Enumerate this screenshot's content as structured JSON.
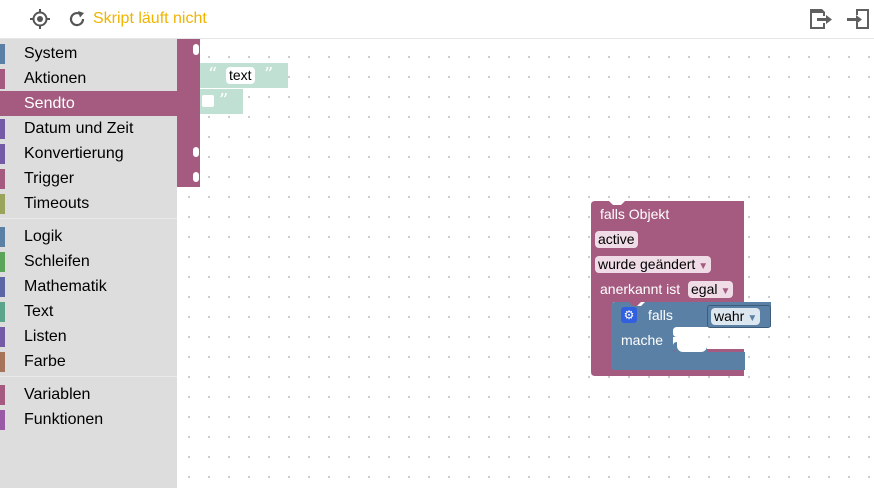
{
  "toolbar": {
    "status": "Skript läuft nicht",
    "icons": [
      "target-icon",
      "refresh-icon",
      "export-icon",
      "import-icon"
    ],
    "status_color": "#f0b400"
  },
  "toolbox": {
    "selected": "Sendto",
    "categories": [
      {
        "label": "System",
        "color": "#5b80a5"
      },
      {
        "label": "Aktionen",
        "color": "#a55b80"
      },
      {
        "label": "Sendto",
        "color": "#a55b80"
      },
      {
        "label": "Datum und Zeit",
        "color": "#745ba5"
      },
      {
        "label": "Konvertierung",
        "color": "#745ba5"
      },
      {
        "label": "Trigger",
        "color": "#a55b80"
      },
      {
        "label": "Timeouts",
        "color": "#9aa55b"
      },
      {
        "label": "Logik",
        "color": "#5b80a5"
      },
      {
        "label": "Schleifen",
        "color": "#5ba55b"
      },
      {
        "label": "Mathematik",
        "color": "#5b67a5"
      },
      {
        "label": "Text",
        "color": "#5ba58c"
      },
      {
        "label": "Listen",
        "color": "#745ba5"
      },
      {
        "label": "Farbe",
        "color": "#a5745b"
      },
      {
        "label": "Variablen",
        "color": "#a55b80"
      },
      {
        "label": "Funktionen",
        "color": "#995ba5"
      }
    ]
  },
  "flyout": {
    "text_block_value": "text",
    "open_quote": "“",
    "close_quote": "”",
    "empty_close_quote": "”"
  },
  "trigger_block": {
    "header": "falls Objekt",
    "object_id": "active",
    "condition": "wurde geändert",
    "ack_label": "anerkannt ist",
    "ack_value": "egal",
    "color": "#a55b80"
  },
  "if_block": {
    "falls_label": "falls",
    "condition_value": "wahr",
    "mache_label": "mache",
    "color": "#5b80a5"
  }
}
